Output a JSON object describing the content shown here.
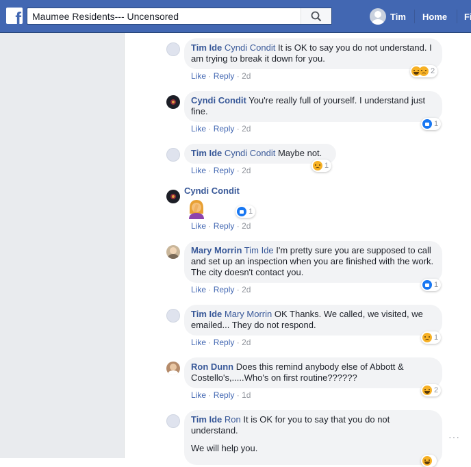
{
  "topbar": {
    "search_value": "Maumee Residents--- Uncensored",
    "user_name": "Tim",
    "nav_home": "Home",
    "nav_partial": "Fi",
    "colors": {
      "bar": "#4267b2",
      "link": "#385898",
      "bubble": "#f2f3f5"
    }
  },
  "comments": [
    {
      "author": "Tim Ide",
      "mention": "Cyndi Condit",
      "text": " It is OK to say you do not understand. I am trying to break it down for you.",
      "like": "Like",
      "reply": "Reply",
      "time": "2d",
      "reaction_count": "2",
      "reaction_icons": [
        "haha",
        "sad"
      ]
    },
    {
      "author": "Cyndi Condit",
      "mention": "",
      "text": " You're really full of yourself. I understand just fine.",
      "like": "Like",
      "reply": "Reply",
      "time": "2d",
      "reaction_count": "1",
      "reaction_icons": [
        "like"
      ]
    },
    {
      "author": "Tim Ide",
      "mention": "Cyndi Condit",
      "text": " Maybe not.",
      "like": "Like",
      "reply": "Reply",
      "time": "2d",
      "reaction_count": "1",
      "reaction_icons": [
        "sad"
      ]
    },
    {
      "author": "Cyndi Condit",
      "sticker": "woman-facepalming",
      "like": "Like",
      "reply": "Reply",
      "time": "2d",
      "reaction_count": "1",
      "reaction_icons": [
        "like"
      ]
    },
    {
      "author": "Mary Morrin",
      "mention": "Tim Ide",
      "text": " I'm pretty sure you are supposed to call and set up an inspection when you are finished with the work. The city doesn't contact you.",
      "like": "Like",
      "reply": "Reply",
      "time": "2d",
      "reaction_count": "1",
      "reaction_icons": [
        "like"
      ]
    },
    {
      "author": "Tim Ide",
      "mention": "Mary Morrin",
      "text": " OK Thanks. We called, we visited, we emailed... They do not respond.",
      "like": "Like",
      "reply": "Reply",
      "time": "2d",
      "reaction_count": "1",
      "reaction_icons": [
        "sad"
      ]
    },
    {
      "author": "Ron Dunn",
      "mention": "",
      "text": " Does this remind anybody else of Abbott & Costello's,.....Who's on first routine??????",
      "like": "Like",
      "reply": "Reply",
      "time": "1d",
      "reaction_count": "2",
      "reaction_icons": [
        "haha"
      ]
    },
    {
      "author": "Tim Ide",
      "mention": "Ron",
      "text": " It is OK for you to say that you do not understand.",
      "text2": "We will help you."
    }
  ],
  "more_menu": "···"
}
